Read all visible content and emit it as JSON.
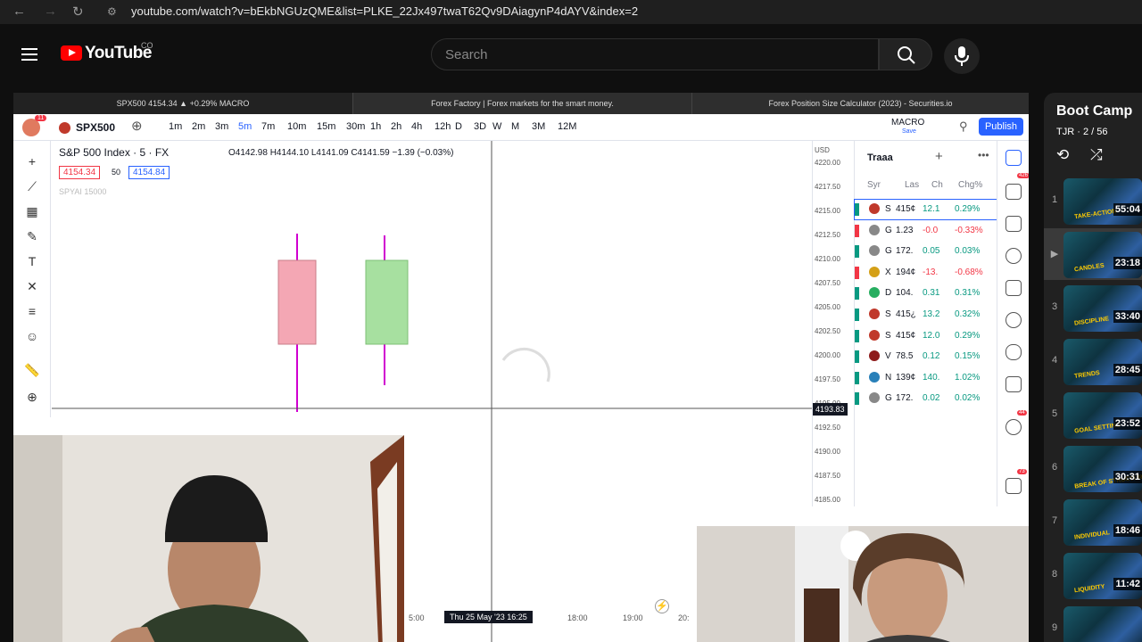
{
  "browser": {
    "url": "youtube.com/watch?v=bEkbNGUzQME&list=PLKE_22Jx497twaT62Qv9DAiagynP4dAYV&index=2"
  },
  "youtube": {
    "logo_text": "YouTube",
    "country": "CO",
    "search_placeholder": "Search"
  },
  "video": {
    "tabs": [
      {
        "label": "SPX500 4154.34 ▲ +0.29% MACRO"
      },
      {
        "label": "Forex Factory | Forex markets for the smart money."
      },
      {
        "label": "Forex Position Size Calculator (2023) - Securities.io"
      }
    ],
    "tradingview": {
      "notif_badge": "11",
      "symbol": "SPX500",
      "timeframes": [
        "1m",
        "2m",
        "3m",
        "5m",
        "7m",
        "10m",
        "15m",
        "30m",
        "1h",
        "2h",
        "4h",
        "12h",
        "D",
        "3D",
        "W",
        "M",
        "3M",
        "12M"
      ],
      "active_timeframe": "5m",
      "layout_name": "MACRO",
      "layout_sub": "Save",
      "publish_label": "Publish",
      "instrument": "S&P 500 Index · 5 · FX",
      "ohlc": "O4142.98  H4144.10  L4141.09  C4141.59  −1.39 (−0.03%)",
      "bid": "4154.34",
      "spread": "50",
      "ask": "4154.84",
      "indicator": "SPYAI 15000",
      "price_scale": {
        "currency": "USD",
        "ticks": [
          "4220.00",
          "4217.50",
          "4215.00",
          "4212.50",
          "4210.00",
          "4207.50",
          "4205.00",
          "4202.50",
          "4200.00",
          "4197.50",
          "4195.00",
          "4192.50",
          "4190.00",
          "4187.50",
          "4185.00"
        ],
        "crosshair_price": "4193.83"
      },
      "time_axis": {
        "labels": [
          "5:00",
          "18:00",
          "19:00",
          "20:"
        ],
        "crosshair_time": "Thu 25 May '23  16:25"
      },
      "watchlist": {
        "title": "Traaa",
        "columns": [
          "Syr",
          "Las",
          "Ch",
          "Chg%"
        ],
        "rows": [
          {
            "letter": "S",
            "last": "415¢",
            "chg": "12.1",
            "chgp": "0.29%",
            "up": true,
            "icon_color": "#c0392b"
          },
          {
            "letter": "G",
            "last": "1.23",
            "chg": "-0.0",
            "chgp": "-0.33%",
            "up": false,
            "icon_color": "#888888"
          },
          {
            "letter": "G",
            "last": "172.",
            "chg": "0.05",
            "chgp": "0.03%",
            "up": true,
            "icon_color": "#888888"
          },
          {
            "letter": "X",
            "last": "194¢",
            "chg": "-13.",
            "chgp": "-0.68%",
            "up": false,
            "icon_color": "#d4a017"
          },
          {
            "letter": "D",
            "last": "104.",
            "chg": "0.31",
            "chgp": "0.31%",
            "up": true,
            "icon_color": "#27ae60"
          },
          {
            "letter": "S",
            "last": "415¿",
            "chg": "13.2",
            "chgp": "0.32%",
            "up": true,
            "icon_color": "#c0392b"
          },
          {
            "letter": "S",
            "last": "415¢",
            "chg": "12.0",
            "chgp": "0.29%",
            "up": true,
            "icon_color": "#c0392b"
          },
          {
            "letter": "V",
            "last": "78.5",
            "chg": "0.12",
            "chgp": "0.15%",
            "up": true,
            "icon_color": "#8e1b1b"
          },
          {
            "letter": "N",
            "last": "139¢",
            "chg": "140.",
            "chgp": "1.02%",
            "up": true,
            "icon_color": "#2980b9"
          },
          {
            "letter": "G",
            "last": "172.",
            "chg": "0.02",
            "chgp": "0.02%",
            "up": true,
            "icon_color": "#888888"
          }
        ]
      },
      "right_badges": {
        "alerts": "426",
        "chat": "44",
        "notifications": "73"
      }
    }
  },
  "playlist": {
    "title": "Boot Camp",
    "subtitle": "TJR · 2 / 56",
    "items": [
      {
        "index": "1",
        "duration": "55:04",
        "word": "TAKE-ACTION"
      },
      {
        "index": "",
        "duration": "23:18",
        "word": "CANDLES",
        "active": true
      },
      {
        "index": "3",
        "duration": "33:40",
        "word": "DISCIPLINE"
      },
      {
        "index": "4",
        "duration": "28:45",
        "word": "TRENDS"
      },
      {
        "index": "5",
        "duration": "23:52",
        "word": "GOAL SETTING"
      },
      {
        "index": "6",
        "duration": "30:31",
        "word": "BREAK OF STRUCTURE"
      },
      {
        "index": "7",
        "duration": "18:46",
        "word": "INDIVIDUAL"
      },
      {
        "index": "8",
        "duration": "11:42",
        "word": "LIQUIDITY"
      },
      {
        "index": "9",
        "duration": "",
        "word": ""
      }
    ]
  }
}
